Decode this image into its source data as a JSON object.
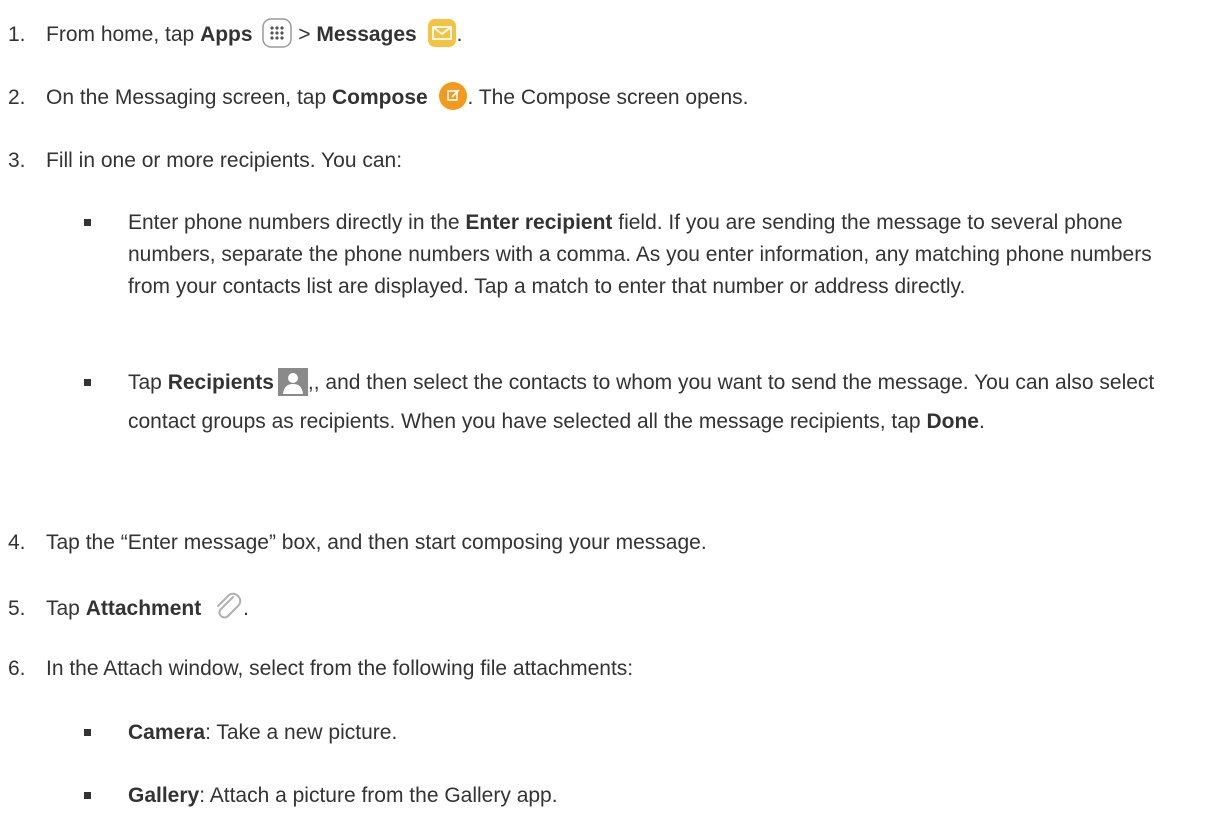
{
  "steps": [
    {
      "num": "1.",
      "pre": "From home, tap ",
      "b1": "Apps",
      "mid": " > ",
      "b2": "Messages",
      "post": "."
    },
    {
      "num": "2.",
      "pre": "On the Messaging screen, tap ",
      "b1": "Compose",
      "post": ". The Compose screen opens."
    },
    {
      "num": "3.",
      "text": "Fill in one or more recipients. You can:"
    },
    {
      "num": "4.",
      "text": "Tap the “Enter message” box, and then start composing your message."
    },
    {
      "num": "5.",
      "pre": "Tap ",
      "b1": "Attachment",
      "post": "."
    },
    {
      "num": "6.",
      "text": "In the Attach window, select from the following file attachments:"
    }
  ],
  "bullets": {
    "recipient_field": {
      "pre": "Enter phone numbers directly in the ",
      "bold": "Enter recipient",
      "post": " field. If you are sending the message to several phone numbers, separate the phone numbers with a comma. As you enter information, any matching phone numbers from your contacts list are displayed. Tap a match to enter that number or address directly."
    },
    "recipients_button": {
      "pre": "Tap ",
      "bold": "Recipients",
      "mid": ",, and then select the contacts to whom you want to send the message. You can also select contact groups as recipients. When you have selected all the message recipients, tap ",
      "bold2": "Done",
      "post": "."
    },
    "camera": {
      "bold": "Camera",
      "post": ": Take a new picture."
    },
    "gallery": {
      "bold": "Gallery",
      "post": ": Attach a picture from the Gallery app."
    }
  },
  "icons": {
    "apps": "apps-grid-icon",
    "messages": "messages-envelope-icon",
    "compose": "compose-icon",
    "recipients": "contact-person-icon",
    "attachment": "paperclip-icon"
  },
  "colors": {
    "text": "#333333",
    "messages_icon": "#f5c342",
    "compose_icon": "#f39a1c",
    "recipients_icon": "#8a8a8a",
    "attachment_icon": "#b0b0b0"
  }
}
